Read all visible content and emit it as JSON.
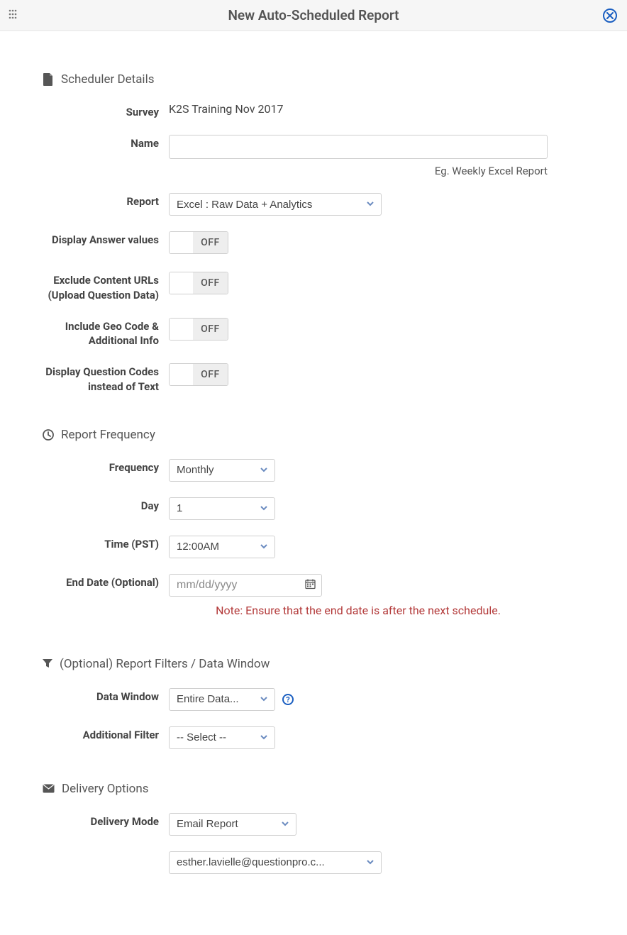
{
  "header": {
    "title": "New Auto-Scheduled Report"
  },
  "sections": {
    "scheduler_details": "Scheduler Details",
    "report_frequency": "Report Frequency",
    "report_filters": "(Optional) Report Filters / Data Window",
    "delivery_options": "Delivery Options"
  },
  "labels": {
    "survey": "Survey",
    "name": "Name",
    "report": "Report",
    "display_answer_values": "Display Answer values",
    "exclude_content_urls": "Exclude Content URLs (Upload Question Data)",
    "include_geo": "Include Geo Code & Additional Info",
    "display_question_codes": "Display Question Codes instead of Text",
    "frequency": "Frequency",
    "day": "Day",
    "time": "Time (PST)",
    "end_date": "End Date (Optional)",
    "data_window": "Data Window",
    "additional_filter": "Additional Filter",
    "delivery_mode": "Delivery Mode"
  },
  "values": {
    "survey": "K2S Training Nov 2017",
    "name": "",
    "name_hint": "Eg. Weekly Excel Report",
    "report_select": "Excel : Raw Data + Analytics",
    "toggle_off": "OFF",
    "frequency": "Monthly",
    "day": "1",
    "time": "12:00AM",
    "end_date_placeholder": "mm/dd/yyyy",
    "end_date_note": "Note: Ensure that the end date is after the next schedule.",
    "data_window": "Entire Data...",
    "additional_filter": "-- Select --",
    "delivery_mode": "Email Report",
    "delivery_email": "esther.lavielle@questionpro.c..."
  }
}
